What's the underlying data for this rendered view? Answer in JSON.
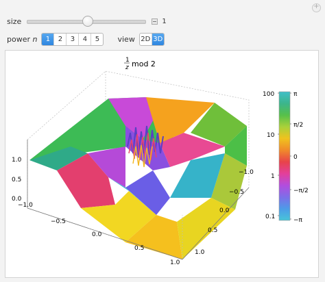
{
  "controls": {
    "size_label": "size",
    "size_value": "1",
    "size_fraction": 0.51,
    "power_label": "power",
    "power_var": "n",
    "power_options": [
      "1",
      "2",
      "3",
      "4",
      "5"
    ],
    "power_selected": "1",
    "view_label": "view",
    "view_options": [
      "2D",
      "3D"
    ],
    "view_selected": "3D"
  },
  "plot": {
    "title_num": "1",
    "title_den": "z",
    "title_rest": "mod 2",
    "vertical_ticks": [
      "1.0",
      "0.5",
      "0.0"
    ],
    "left_axis_ticks": [
      "−1.0",
      "−0.5",
      "0.0",
      "0.5",
      "1.0"
    ],
    "right_axis_ticks": [
      "−1.0",
      "−0.5",
      "0.0",
      "0.5",
      "1.0"
    ],
    "colorbar_left_ticks": [
      "100",
      "10",
      "1",
      "0.1"
    ],
    "colorbar_right_ticks": [
      "π",
      "π/2",
      "0",
      "−π/2",
      "−π"
    ],
    "colorbar_colors": [
      "#3fbfc8",
      "#3cb58c",
      "#56c04a",
      "#a9d13a",
      "#f0c21e",
      "#f08a2a",
      "#e8434a",
      "#e33f9a",
      "#b24dde",
      "#7d6ee8",
      "#4d9be8",
      "#48c5d8"
    ]
  }
}
